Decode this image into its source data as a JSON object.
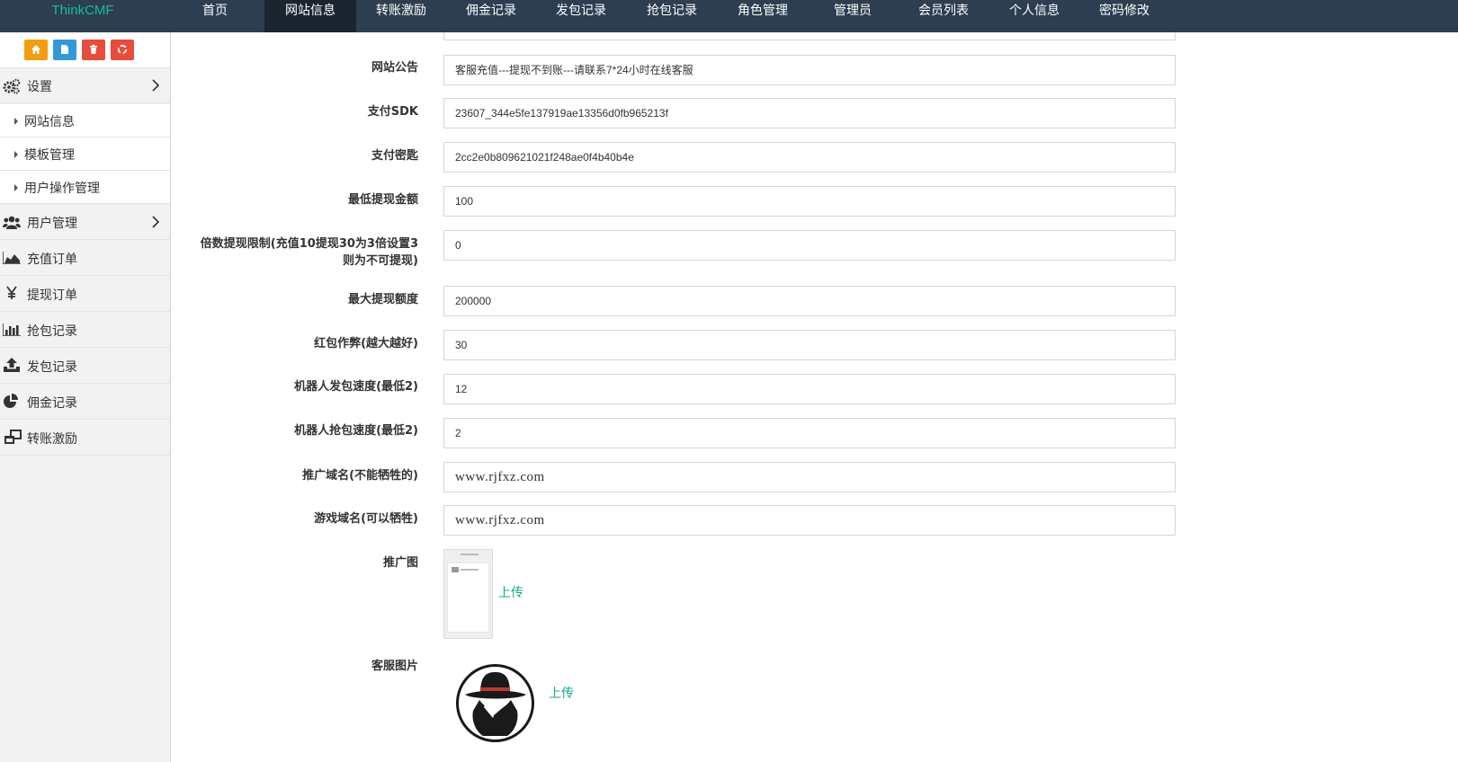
{
  "brand": "ThinkCMF",
  "nav": [
    {
      "label": "首页",
      "active": false
    },
    {
      "label": "网站信息",
      "active": true
    },
    {
      "label": "转账激励",
      "active": false
    },
    {
      "label": "佣金记录",
      "active": false
    },
    {
      "label": "发包记录",
      "active": false
    },
    {
      "label": "抢包记录",
      "active": false
    },
    {
      "label": "角色管理",
      "active": false
    },
    {
      "label": "管理员",
      "active": false
    },
    {
      "label": "会员列表",
      "active": false
    },
    {
      "label": "个人信息",
      "active": false
    },
    {
      "label": "密码修改",
      "active": false
    }
  ],
  "shortcuts": [
    {
      "icon": "home-icon",
      "color": "#f39c12"
    },
    {
      "icon": "file-icon",
      "color": "#3498db"
    },
    {
      "icon": "trash-icon",
      "color": "#e74c3c"
    },
    {
      "icon": "recycle-icon",
      "color": "#e74c3c"
    }
  ],
  "sidebar": {
    "settings": {
      "label": "设置",
      "icon": "gears-icon"
    },
    "sub_items": [
      {
        "label": "网站信息"
      },
      {
        "label": "模板管理"
      },
      {
        "label": "用户操作管理"
      }
    ],
    "items": [
      {
        "label": "用户管理",
        "icon": "users-icon",
        "has_children": true
      },
      {
        "label": "充值订单",
        "icon": "area-chart-icon"
      },
      {
        "label": "提现订单",
        "icon": "yen-icon"
      },
      {
        "label": "抢包记录",
        "icon": "bar-chart-icon"
      },
      {
        "label": "发包记录",
        "icon": "upload-icon"
      },
      {
        "label": "佣金记录",
        "icon": "pie-chart-icon"
      },
      {
        "label": "转账激励",
        "icon": "windows-icon"
      }
    ]
  },
  "form": {
    "fields": [
      {
        "label": "网站公告",
        "value": "客服充值---提现不到账---请联系7*24小时在线客服"
      },
      {
        "label": "支付SDK",
        "value": "23607_344e5fe137919ae13356d0fb965213f"
      },
      {
        "label": "支付密匙",
        "value": "2cc2e0b809621021f248ae0f4b40b4e"
      },
      {
        "label": "最低提现金额",
        "value": "100"
      },
      {
        "label_line1": "倍数提现限制(充值10提现30为3倍设置3",
        "label_line2": "则为不可提现)",
        "value": "0"
      },
      {
        "label": "最大提现额度",
        "value": "200000"
      },
      {
        "label": "红包作弊(越大越好)",
        "value": "30"
      },
      {
        "label": "机器人发包速度(最低2)",
        "value": "12"
      },
      {
        "label": "机器人抢包速度(最低2)",
        "value": "2"
      },
      {
        "label": "推广域名(不能牺牲的)",
        "value": "www.rjfxz.com"
      },
      {
        "label": "游戏域名(可以牺牲)",
        "value": "www.rjfxz.com"
      }
    ],
    "promo_image": {
      "label": "推广图",
      "upload": "上传"
    },
    "service_image": {
      "label": "客服图片",
      "upload": "上传"
    }
  }
}
